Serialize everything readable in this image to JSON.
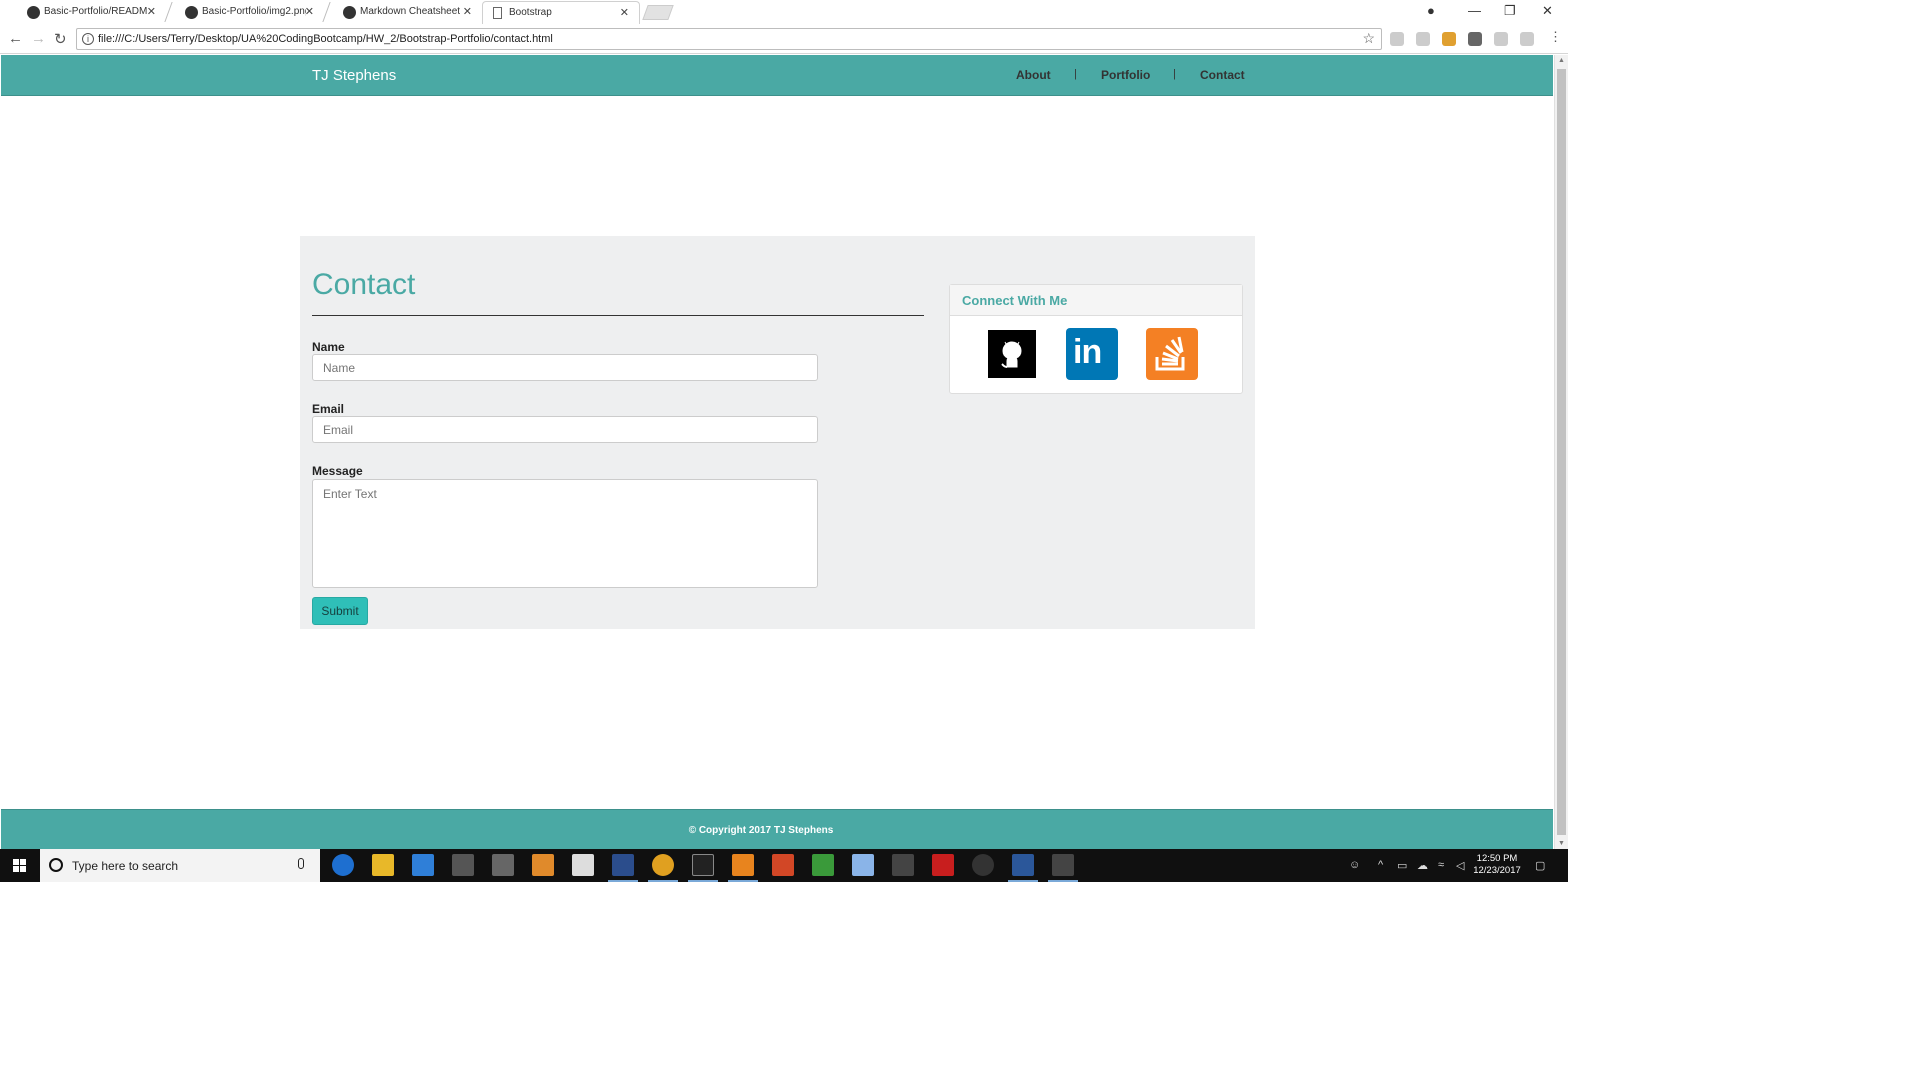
{
  "browser": {
    "tabs": [
      {
        "label": "Basic-Portfolio/README",
        "icon": "github-icon",
        "active": false
      },
      {
        "label": "Basic-Portfolio/img2.png",
        "icon": "github-icon",
        "active": false
      },
      {
        "label": "Markdown Cheatsheet · a",
        "icon": "github-icon",
        "active": false
      },
      {
        "label": "Bootstrap",
        "icon": "document-icon",
        "active": true
      }
    ],
    "url": "file:///C:/Users/Terry/Desktop/UA%20CodingBootcamp/HW_2/Bootstrap-Portfolio/contact.html"
  },
  "site": {
    "brand": "TJ Stephens",
    "nav": [
      {
        "label": "About"
      },
      {
        "label": "Portfolio"
      },
      {
        "label": "Contact"
      }
    ],
    "nav_separator": "|",
    "accent_color": "#4aa9a4",
    "footer": "© Copyright 2017 TJ Stephens"
  },
  "contact": {
    "title": "Contact",
    "name_label": "Name",
    "name_placeholder": "Name",
    "email_label": "Email",
    "email_placeholder": "Email",
    "message_label": "Message",
    "message_placeholder": "Enter Text",
    "submit_label": "Submit"
  },
  "connect": {
    "heading": "Connect With Me",
    "icons": [
      "github-icon",
      "linkedin-icon",
      "stackoverflow-icon"
    ],
    "linkedin_text": "in"
  },
  "taskbar": {
    "search_placeholder": "Type here to search",
    "time": "12:50 PM",
    "date": "12/23/2017",
    "apps": [
      "edge-icon",
      "file-explorer-icon",
      "store-icon",
      "app-icon",
      "app-icon",
      "media-icon",
      "mail-icon",
      "visual-studio-icon",
      "chrome-icon",
      "terminal-icon",
      "sublime-icon",
      "powerpoint-icon",
      "app-icon",
      "app-icon",
      "settings-icon",
      "acrobat-icon",
      "app-icon",
      "word-icon",
      "photos-icon"
    ]
  }
}
